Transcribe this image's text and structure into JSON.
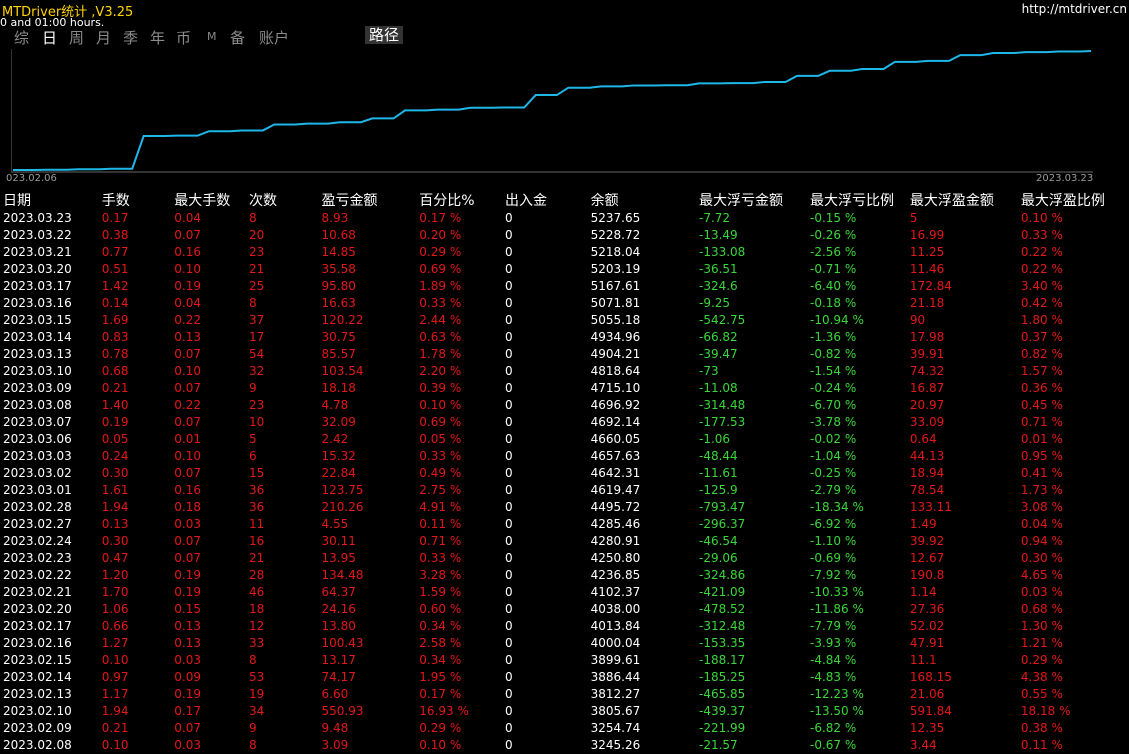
{
  "header": {
    "title": "MTDriver统计 ,V3.25",
    "subtitle": "0 and 01:00 hours.",
    "url": "http://mtdriver.cn"
  },
  "tabs": [
    "综",
    "日",
    "周",
    "月",
    "季",
    "年",
    "币",
    "M",
    "备",
    "账户"
  ],
  "active_tab": "日",
  "path_button": "路径",
  "chart_data": {
    "type": "line",
    "color": "#1fb6e8",
    "x_start_label": "023.02.06",
    "x_end_label": "2023.03.23",
    "x": [
      "2023.02.06",
      "2023.02.07",
      "2023.02.08",
      "2023.02.09",
      "2023.02.10",
      "2023.02.13",
      "2023.02.14",
      "2023.02.15",
      "2023.02.16",
      "2023.02.17",
      "2023.02.20",
      "2023.02.21",
      "2023.02.22",
      "2023.02.23",
      "2023.02.24",
      "2023.02.27",
      "2023.02.28",
      "2023.03.01",
      "2023.03.02",
      "2023.03.03",
      "2023.03.06",
      "2023.03.07",
      "2023.03.08",
      "2023.03.09",
      "2023.03.10",
      "2023.03.13",
      "2023.03.14",
      "2023.03.15",
      "2023.03.16",
      "2023.03.17",
      "2023.03.20",
      "2023.03.21",
      "2023.03.22",
      "2023.03.23"
    ],
    "values": [
      3233.5,
      3236.69,
      3245.26,
      3254.74,
      3805.67,
      3812.27,
      3886.44,
      3899.61,
      4000.04,
      4013.84,
      4038.0,
      4102.37,
      4236.85,
      4250.8,
      4280.91,
      4285.46,
      4495.72,
      4619.47,
      4642.31,
      4657.63,
      4660.05,
      4692.14,
      4696.92,
      4715.1,
      4818.64,
      4904.21,
      4934.96,
      5055.18,
      5071.81,
      5167.61,
      5203.19,
      5218.04,
      5228.72,
      5237.65
    ]
  },
  "table": {
    "headers": [
      "日期",
      "手数",
      "最大手数",
      "次数",
      "盈亏金额",
      "百分比%",
      "出入金",
      "余额",
      "最大浮亏金额",
      "最大浮亏比例",
      "最大浮盈金额",
      "最大浮盈比例"
    ],
    "rows": [
      [
        "2023.03.23",
        "0.17",
        "0.04",
        "8",
        "8.93",
        "0.17 %",
        "0",
        "5237.65",
        "-7.72",
        "-0.15 %",
        "5",
        "0.10 %"
      ],
      [
        "2023.03.22",
        "0.38",
        "0.07",
        "20",
        "10.68",
        "0.20 %",
        "0",
        "5228.72",
        "-13.49",
        "-0.26 %",
        "16.99",
        "0.33 %"
      ],
      [
        "2023.03.21",
        "0.77",
        "0.16",
        "23",
        "14.85",
        "0.29 %",
        "0",
        "5218.04",
        "-133.08",
        "-2.56 %",
        "11.25",
        "0.22 %"
      ],
      [
        "2023.03.20",
        "0.51",
        "0.10",
        "21",
        "35.58",
        "0.69 %",
        "0",
        "5203.19",
        "-36.51",
        "-0.71 %",
        "11.46",
        "0.22 %"
      ],
      [
        "2023.03.17",
        "1.42",
        "0.19",
        "25",
        "95.80",
        "1.89 %",
        "0",
        "5167.61",
        "-324.6",
        "-6.40 %",
        "172.84",
        "3.40 %"
      ],
      [
        "2023.03.16",
        "0.14",
        "0.04",
        "8",
        "16.63",
        "0.33 %",
        "0",
        "5071.81",
        "-9.25",
        "-0.18 %",
        "21.18",
        "0.42 %"
      ],
      [
        "2023.03.15",
        "1.69",
        "0.22",
        "37",
        "120.22",
        "2.44 %",
        "0",
        "5055.18",
        "-542.75",
        "-10.94 %",
        "90",
        "1.80 %"
      ],
      [
        "2023.03.14",
        "0.83",
        "0.13",
        "17",
        "30.75",
        "0.63 %",
        "0",
        "4934.96",
        "-66.82",
        "-1.36 %",
        "17.98",
        "0.37 %"
      ],
      [
        "2023.03.13",
        "0.78",
        "0.07",
        "54",
        "85.57",
        "1.78 %",
        "0",
        "4904.21",
        "-39.47",
        "-0.82 %",
        "39.91",
        "0.82 %"
      ],
      [
        "2023.03.10",
        "0.68",
        "0.10",
        "32",
        "103.54",
        "2.20 %",
        "0",
        "4818.64",
        "-73",
        "-1.54 %",
        "74.32",
        "1.57 %"
      ],
      [
        "2023.03.09",
        "0.21",
        "0.07",
        "9",
        "18.18",
        "0.39 %",
        "0",
        "4715.10",
        "-11.08",
        "-0.24 %",
        "16.87",
        "0.36 %"
      ],
      [
        "2023.03.08",
        "1.40",
        "0.22",
        "23",
        "4.78",
        "0.10 %",
        "0",
        "4696.92",
        "-314.48",
        "-6.70 %",
        "20.97",
        "0.45 %"
      ],
      [
        "2023.03.07",
        "0.19",
        "0.07",
        "10",
        "32.09",
        "0.69 %",
        "0",
        "4692.14",
        "-177.53",
        "-3.78 %",
        "33.09",
        "0.71 %"
      ],
      [
        "2023.03.06",
        "0.05",
        "0.01",
        "5",
        "2.42",
        "0.05 %",
        "0",
        "4660.05",
        "-1.06",
        "-0.02 %",
        "0.64",
        "0.01 %"
      ],
      [
        "2023.03.03",
        "0.24",
        "0.10",
        "6",
        "15.32",
        "0.33 %",
        "0",
        "4657.63",
        "-48.44",
        "-1.04 %",
        "44.13",
        "0.95 %"
      ],
      [
        "2023.03.02",
        "0.30",
        "0.07",
        "15",
        "22.84",
        "0.49 %",
        "0",
        "4642.31",
        "-11.61",
        "-0.25 %",
        "18.94",
        "0.41 %"
      ],
      [
        "2023.03.01",
        "1.61",
        "0.16",
        "36",
        "123.75",
        "2.75 %",
        "0",
        "4619.47",
        "-125.9",
        "-2.79 %",
        "78.54",
        "1.73 %"
      ],
      [
        "2023.02.28",
        "1.94",
        "0.18",
        "36",
        "210.26",
        "4.91 %",
        "0",
        "4495.72",
        "-793.47",
        "-18.34 %",
        "133.11",
        "3.08 %"
      ],
      [
        "2023.02.27",
        "0.13",
        "0.03",
        "11",
        "4.55",
        "0.11 %",
        "0",
        "4285.46",
        "-296.37",
        "-6.92 %",
        "1.49",
        "0.04 %"
      ],
      [
        "2023.02.24",
        "0.30",
        "0.07",
        "16",
        "30.11",
        "0.71 %",
        "0",
        "4280.91",
        "-46.54",
        "-1.10 %",
        "39.92",
        "0.94 %"
      ],
      [
        "2023.02.23",
        "0.47",
        "0.07",
        "21",
        "13.95",
        "0.33 %",
        "0",
        "4250.80",
        "-29.06",
        "-0.69 %",
        "12.67",
        "0.30 %"
      ],
      [
        "2023.02.22",
        "1.20",
        "0.19",
        "28",
        "134.48",
        "3.28 %",
        "0",
        "4236.85",
        "-324.86",
        "-7.92 %",
        "190.8",
        "4.65 %"
      ],
      [
        "2023.02.21",
        "1.70",
        "0.19",
        "46",
        "64.37",
        "1.59 %",
        "0",
        "4102.37",
        "-421.09",
        "-10.33 %",
        "1.14",
        "0.03 %"
      ],
      [
        "2023.02.20",
        "1.06",
        "0.15",
        "18",
        "24.16",
        "0.60 %",
        "0",
        "4038.00",
        "-478.52",
        "-11.86 %",
        "27.36",
        "0.68 %"
      ],
      [
        "2023.02.17",
        "0.66",
        "0.13",
        "12",
        "13.80",
        "0.34 %",
        "0",
        "4013.84",
        "-312.48",
        "-7.79 %",
        "52.02",
        "1.30 %"
      ],
      [
        "2023.02.16",
        "1.27",
        "0.13",
        "33",
        "100.43",
        "2.58 %",
        "0",
        "4000.04",
        "-153.35",
        "-3.93 %",
        "47.91",
        "1.21 %"
      ],
      [
        "2023.02.15",
        "0.10",
        "0.03",
        "8",
        "13.17",
        "0.34 %",
        "0",
        "3899.61",
        "-188.17",
        "-4.84 %",
        "11.1",
        "0.29 %"
      ],
      [
        "2023.02.14",
        "0.97",
        "0.09",
        "53",
        "74.17",
        "1.95 %",
        "0",
        "3886.44",
        "-185.25",
        "-4.83 %",
        "168.15",
        "4.38 %"
      ],
      [
        "2023.02.13",
        "1.17",
        "0.19",
        "19",
        "6.60",
        "0.17 %",
        "0",
        "3812.27",
        "-465.85",
        "-12.23 %",
        "21.06",
        "0.55 %"
      ],
      [
        "2023.02.10",
        "1.94",
        "0.17",
        "34",
        "550.93",
        "16.93 %",
        "0",
        "3805.67",
        "-439.37",
        "-13.50 %",
        "591.84",
        "18.18 %"
      ],
      [
        "2023.02.09",
        "0.21",
        "0.07",
        "9",
        "9.48",
        "0.29 %",
        "0",
        "3254.74",
        "-221.99",
        "-6.82 %",
        "12.35",
        "0.38 %"
      ],
      [
        "2023.02.08",
        "0.10",
        "0.03",
        "8",
        "3.09",
        "0.10 %",
        "0",
        "3245.26",
        "-21.57",
        "-0.67 %",
        "3.44",
        "0.11 %"
      ]
    ]
  }
}
